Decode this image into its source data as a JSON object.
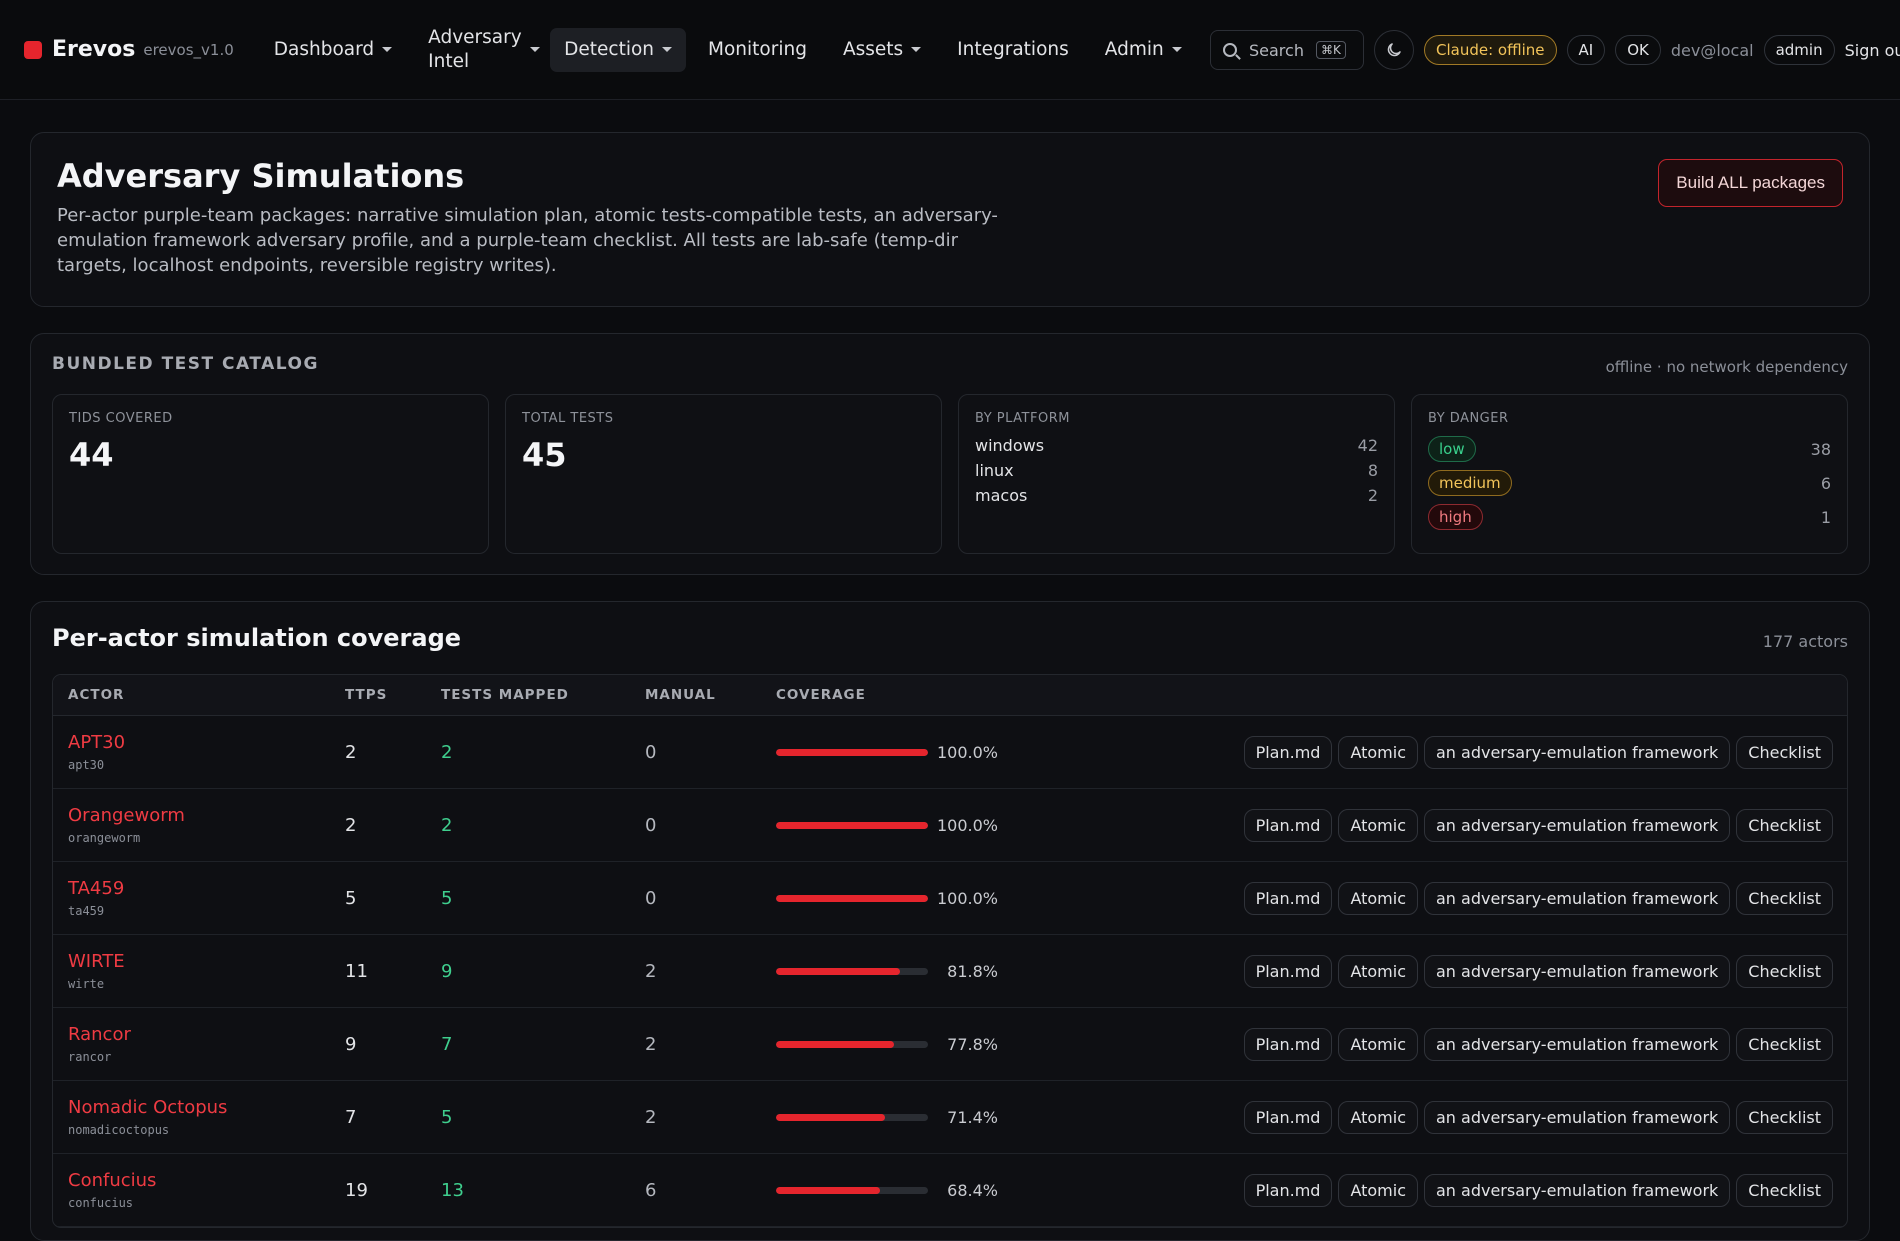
{
  "header": {
    "brand": "Erevos",
    "version": "erevos_v1.0",
    "nav": [
      {
        "label": "Dashboard",
        "caret": true
      },
      {
        "label": "Adversary Intel",
        "caret": true
      },
      {
        "label": "Detection",
        "caret": true,
        "active": true
      },
      {
        "label": "Monitoring",
        "caret": false
      },
      {
        "label": "Assets",
        "caret": true
      },
      {
        "label": "Integrations",
        "caret": false
      },
      {
        "label": "Admin",
        "caret": true
      }
    ],
    "search_label": "Search",
    "search_shortcut": "⌘K",
    "claude_status": "Claude: offline",
    "ai_label": "AI",
    "ok_label": "OK",
    "user": "dev@local",
    "role": "admin",
    "signout": "Sign ou"
  },
  "hero": {
    "title": "Adversary Simulations",
    "description": "Per-actor purple-team packages: narrative simulation plan, atomic tests-compatible tests, an adversary-emulation framework adversary profile, and a purple-team checklist. All tests are lab-safe (temp-dir targets, localhost endpoints, reversible registry writes).",
    "build_button": "Build ALL packages"
  },
  "catalog": {
    "title": "BUNDLED TEST CATALOG",
    "note": "offline · no network dependency",
    "tids_label": "TIDS COVERED",
    "tids_value": "44",
    "tests_label": "TOTAL TESTS",
    "tests_value": "45",
    "platform_label": "BY PLATFORM",
    "platforms": [
      {
        "name": "windows",
        "count": "42"
      },
      {
        "name": "linux",
        "count": "8"
      },
      {
        "name": "macos",
        "count": "2"
      }
    ],
    "danger_label": "BY DANGER",
    "danger": [
      {
        "level": "low",
        "count": "38"
      },
      {
        "level": "medium",
        "count": "6"
      },
      {
        "level": "high",
        "count": "1"
      }
    ]
  },
  "coverage": {
    "title": "Per-actor simulation coverage",
    "actor_count": "177 actors",
    "columns": [
      "ACTOR",
      "TTPS",
      "TESTS MAPPED",
      "MANUAL",
      "COVERAGE"
    ],
    "action_labels": [
      "Plan.md",
      "Atomic",
      "an adversary-emulation framework",
      "Checklist"
    ],
    "rows": [
      {
        "name": "APT30",
        "slug": "apt30",
        "ttps": "2",
        "mapped": "2",
        "manual": "0",
        "coverage": "100.0%",
        "fraction": 1.0
      },
      {
        "name": "Orangeworm",
        "slug": "orangeworm",
        "ttps": "2",
        "mapped": "2",
        "manual": "0",
        "coverage": "100.0%",
        "fraction": 1.0
      },
      {
        "name": "TA459",
        "slug": "ta459",
        "ttps": "5",
        "mapped": "5",
        "manual": "0",
        "coverage": "100.0%",
        "fraction": 1.0
      },
      {
        "name": "WIRTE",
        "slug": "wirte",
        "ttps": "11",
        "mapped": "9",
        "manual": "2",
        "coverage": "81.8%",
        "fraction": 0.818
      },
      {
        "name": "Rancor",
        "slug": "rancor",
        "ttps": "9",
        "mapped": "7",
        "manual": "2",
        "coverage": "77.8%",
        "fraction": 0.778
      },
      {
        "name": "Nomadic Octopus",
        "slug": "nomadicoctopus",
        "ttps": "7",
        "mapped": "5",
        "manual": "2",
        "coverage": "71.4%",
        "fraction": 0.714
      },
      {
        "name": "Confucius",
        "slug": "confucius",
        "ttps": "19",
        "mapped": "13",
        "manual": "6",
        "coverage": "68.4%",
        "fraction": 0.684
      }
    ]
  },
  "colors": {
    "accent": "#e5252d",
    "mapped": "#3fcf8e",
    "background": "#0b0c0f"
  }
}
